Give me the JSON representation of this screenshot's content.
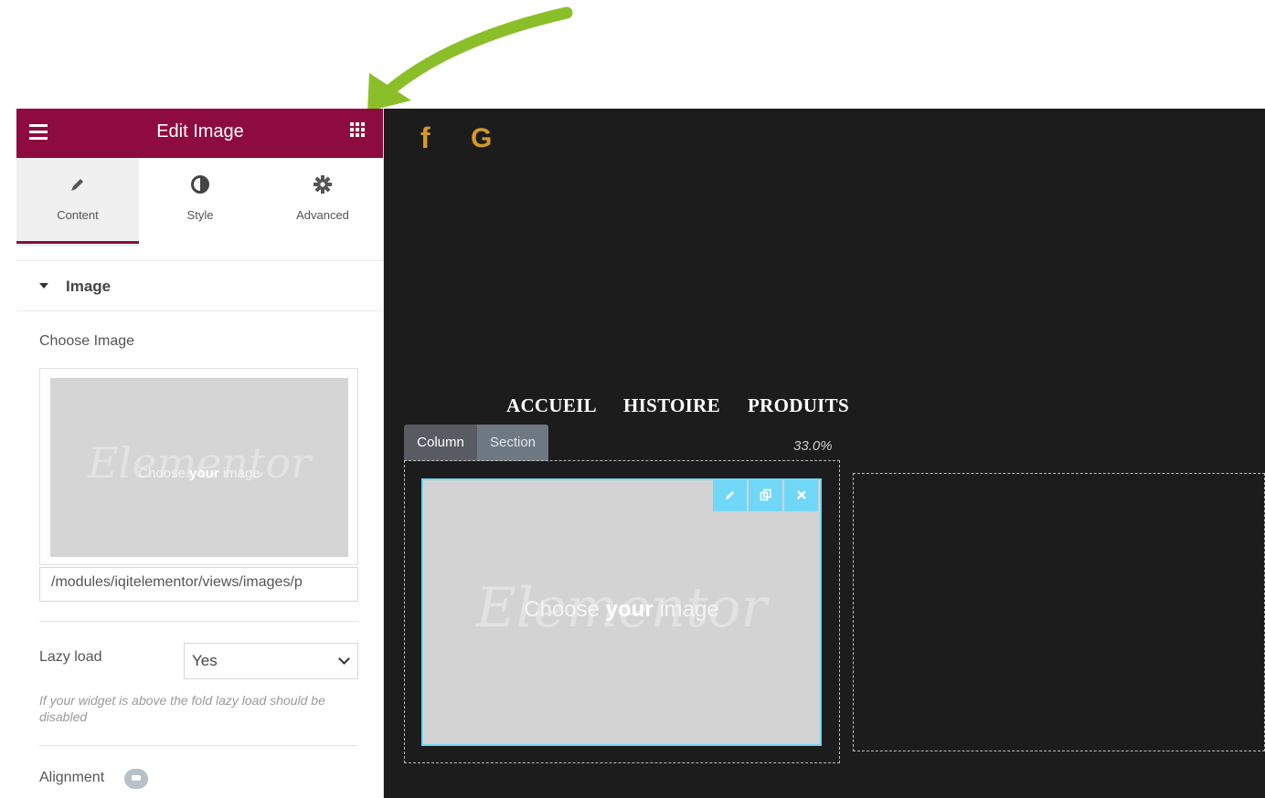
{
  "panel": {
    "title": "Edit Image",
    "tabs": [
      {
        "label": "Content",
        "icon": "pencil-icon"
      },
      {
        "label": "Style",
        "icon": "half-circle-icon"
      },
      {
        "label": "Advanced",
        "icon": "gear-icon"
      }
    ],
    "section_title": "Image",
    "choose_image_label": "Choose Image",
    "media_watermark": "Elementor",
    "media_placeholder": {
      "pre": "Choose ",
      "bold": "your",
      "post": " image"
    },
    "image_url": "/modules/iqitelementor/views/images/p",
    "lazy_load_label": "Lazy load",
    "lazy_load_value": "Yes",
    "lazy_load_help": "If your widget is above the fold lazy load should be disabled",
    "alignment_label": "Alignment"
  },
  "canvas": {
    "social": {
      "facebook": "f",
      "google": "G"
    },
    "nav": [
      "ACCUEIL",
      "HISTOIRE",
      "PRODUITS"
    ],
    "column_tab": "Column",
    "section_tab": "Section",
    "column_width": "33.0%",
    "widget_watermark": "Elementor",
    "widget_placeholder": {
      "pre": "Choose ",
      "bold": "your",
      "post": " image"
    }
  },
  "colors": {
    "brand": "#8e0b3f",
    "arrow": "#8bbf2a",
    "accent": "#71d7f7",
    "social": "#d49a2a",
    "canvas_bg": "#1c1c1c"
  }
}
